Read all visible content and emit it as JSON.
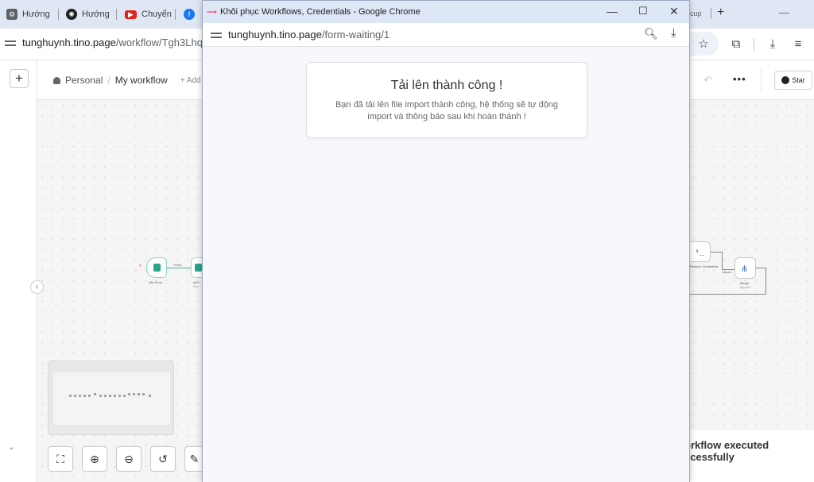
{
  "background_browser": {
    "tabs": [
      {
        "title": "Hướng",
        "icon": "settings-app-icon"
      },
      {
        "title": "Hướng",
        "icon": "openai-icon"
      },
      {
        "title": "Chuyển",
        "icon": "youtube-icon"
      },
      {
        "title": "",
        "icon": "facebook-icon"
      }
    ],
    "right_tab_fragment": "cup",
    "url_domain": "tunghuynh.tino.page",
    "url_path": "/workflow/Tgh3Lhqia",
    "accent_color": "#dfe7f5"
  },
  "n8n": {
    "breadcrumb": {
      "project": "Personal",
      "separator": "/",
      "workflow": "My workflow",
      "add_tag": "+ Add"
    },
    "header": {
      "more": "•••",
      "star_label": "Star"
    },
    "nodes": {
      "n1_label": "n8n Form",
      "n2_label": "n8n f",
      "n2_sub": "Run",
      "edge_label": "Form",
      "right_code_label": "Restore Credentials",
      "right_code_glyph": "›_",
      "merge_label": "Merge",
      "merge_sub": "append",
      "merge_edge_label": "Input 1"
    },
    "zoom_controls": [
      "fit-view-icon",
      "zoom-in-icon",
      "zoom-out-icon",
      "reset-zoom-icon",
      "tidy-up-icon"
    ],
    "toast": {
      "line1": "orkflow executed",
      "line2": "ccessfully"
    }
  },
  "popup": {
    "window_title": "Khôi phục Workflows, Credentials - Google Chrome",
    "url_domain": "tunghuynh.tino.page",
    "url_path": "/form-waiting/1",
    "card_title": "Tải lên thành công !",
    "card_message": "Bạn đã tải lên file import thành công, hệ thống sẽ tự động import và thông báo sau khi hoàn thành !"
  }
}
